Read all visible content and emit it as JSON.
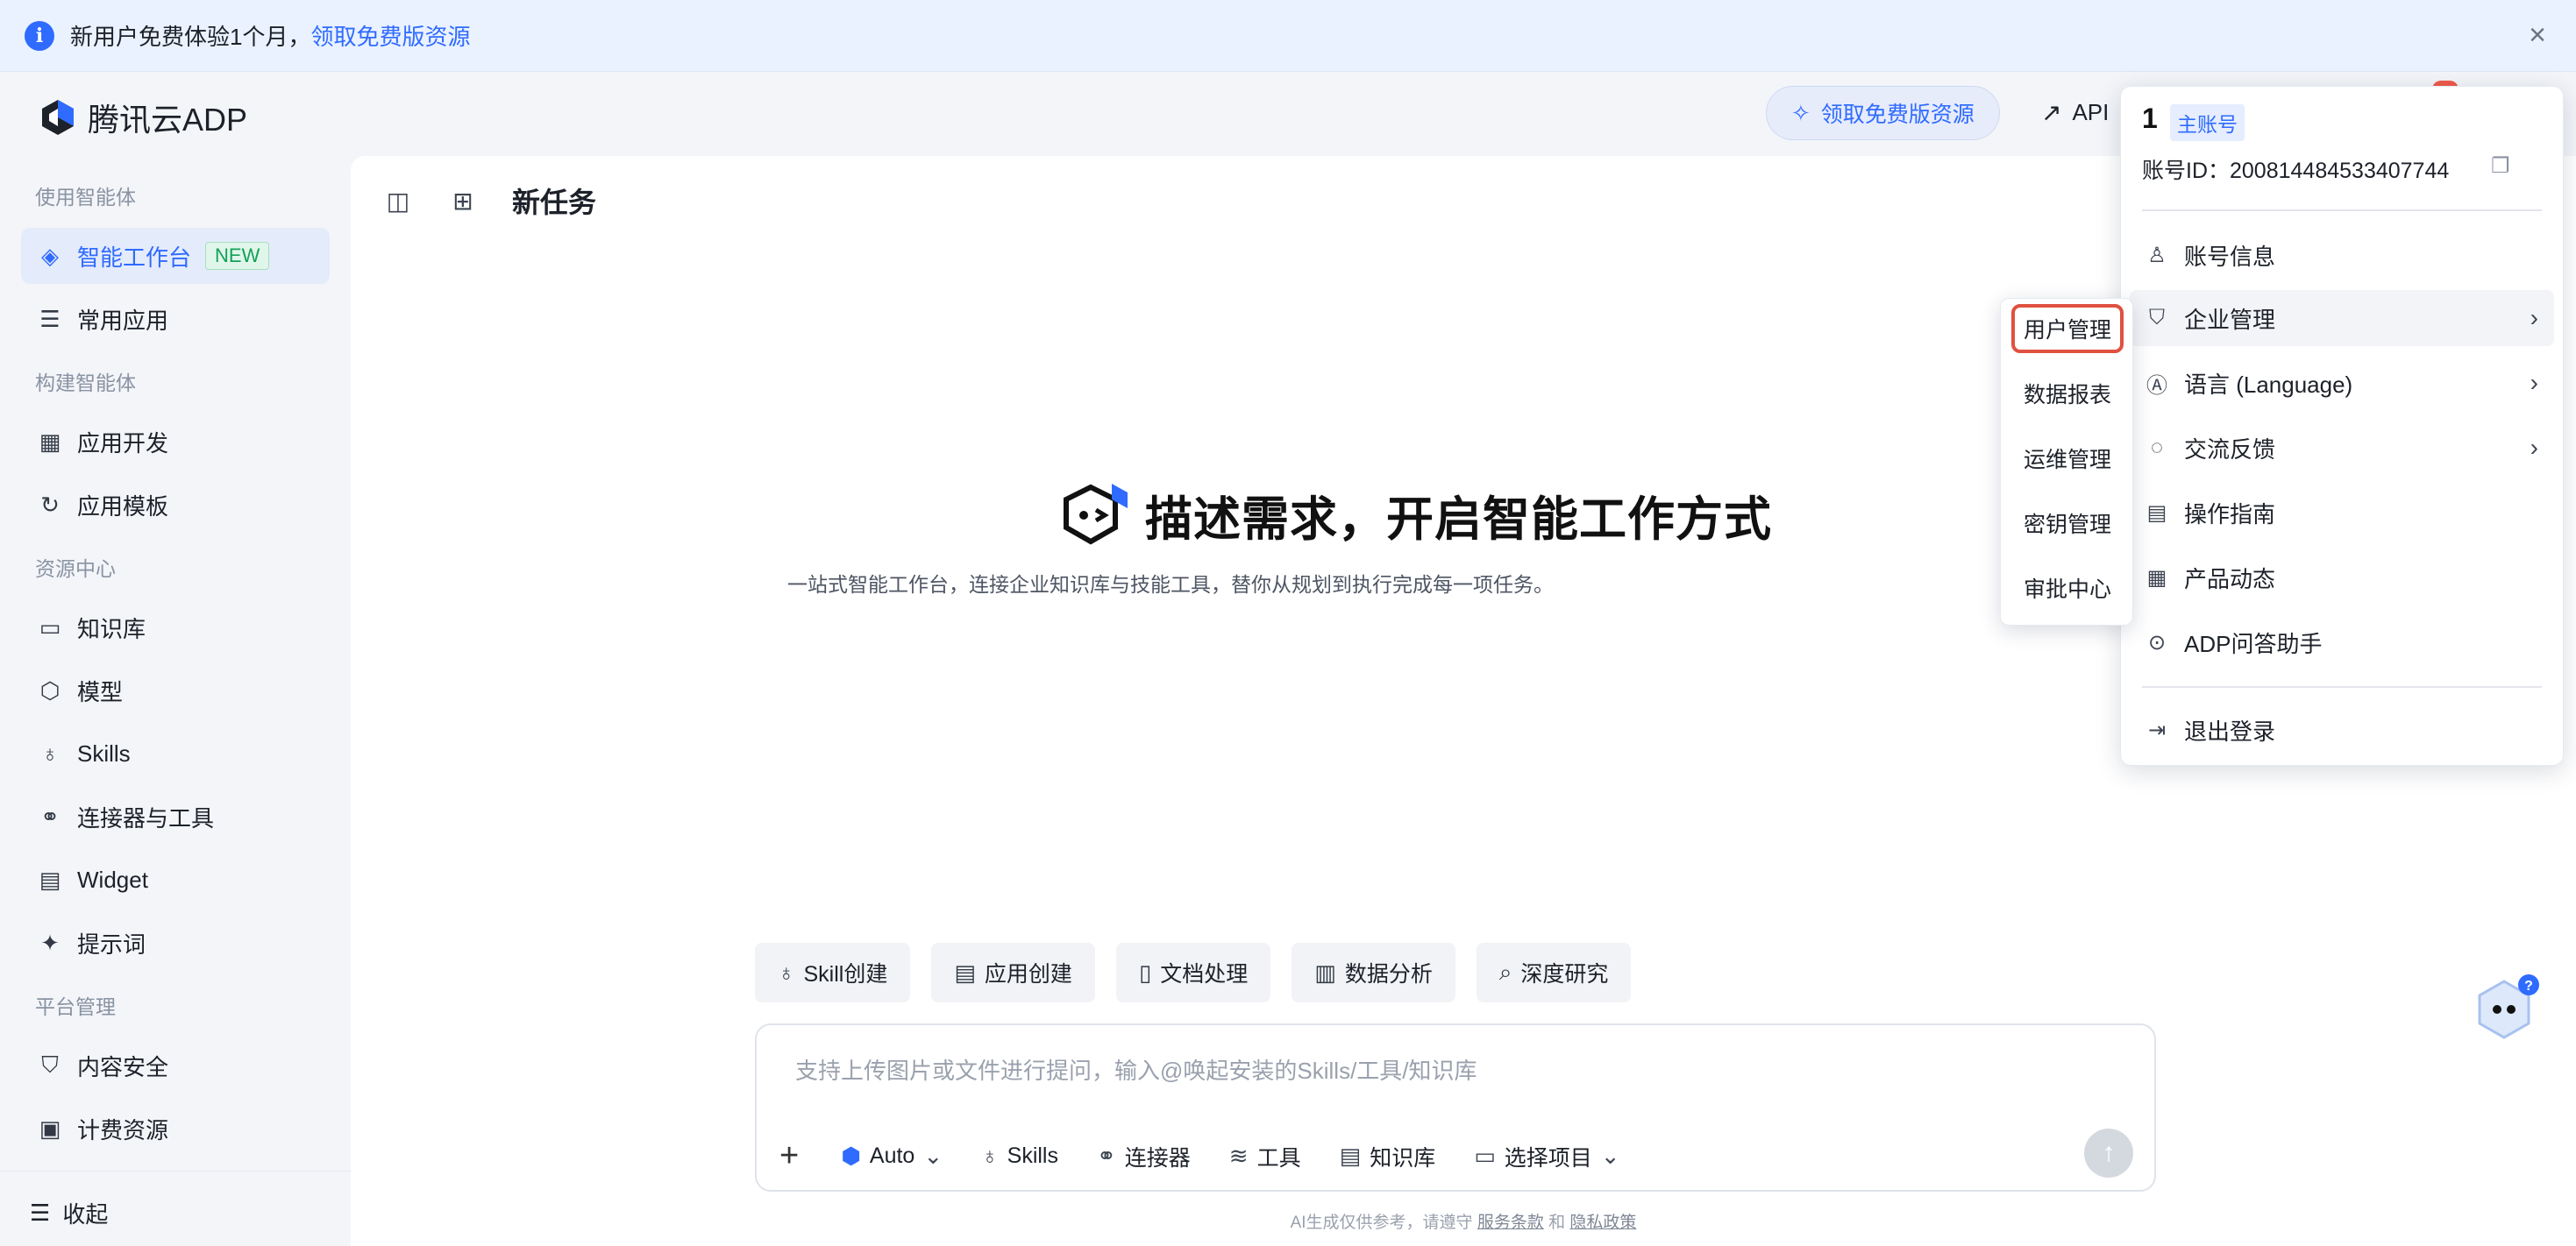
{
  "banner": {
    "text": "新用户免费体验1个月，",
    "link": "领取免费版资源"
  },
  "header": {
    "logo_text": "腾讯云ADP",
    "free_pill": "领取免费版资源",
    "api_link": "API"
  },
  "sidebar": {
    "group1": "使用智能体",
    "workbench": "智能工作台",
    "new_badge": "NEW",
    "common_apps": "常用应用",
    "group2": "构建智能体",
    "app_dev": "应用开发",
    "app_template": "应用模板",
    "group3": "资源中心",
    "knowledge": "知识库",
    "model": "模型",
    "skills": "Skills",
    "connectors": "连接器与工具",
    "widget": "Widget",
    "prompts": "提示词",
    "group4": "平台管理",
    "content_safety": "内容安全",
    "billing": "计费资源",
    "collapse": "收起"
  },
  "main": {
    "title": "新任务",
    "hero_title": "描述需求，开启智能工作方式",
    "hero_sub": "一站式智能工作台，连接企业知识库与技能工具，替你从规划到执行完成每一项任务。",
    "chips": {
      "skill": "Skill创建",
      "app": "应用创建",
      "doc": "文档处理",
      "data": "数据分析",
      "research": "深度研究"
    },
    "composer": {
      "placeholder": "支持上传图片或文件进行提问，输入@唤起安装的Skills/工具/知识库",
      "model": "Auto",
      "skills": "Skills",
      "connector": "连接器",
      "tools": "工具",
      "kb": "知识库",
      "project": "选择项目"
    },
    "footnote": {
      "prefix": "AI生成仅供参考，请遵守",
      "terms": "服务条款",
      "and": "和",
      "privacy": "隐私政策"
    }
  },
  "account": {
    "name": "1",
    "role": "主账号",
    "id_line": "账号ID：200814484533407744",
    "items": {
      "info": "账号信息",
      "enterprise": "企业管理",
      "language": "语言 (Language)",
      "feedback": "交流反馈",
      "guide": "操作指南",
      "news": "产品动态",
      "assistant": "ADP问答助手",
      "logout": "退出登录"
    }
  },
  "submenu": {
    "users": "用户管理",
    "reports": "数据报表",
    "ops": "运维管理",
    "keys": "密钥管理",
    "approval": "审批中心"
  },
  "colors": {
    "accent": "#2f6bff",
    "highlight": "#e0513f",
    "new_badge": "#14a05a"
  }
}
